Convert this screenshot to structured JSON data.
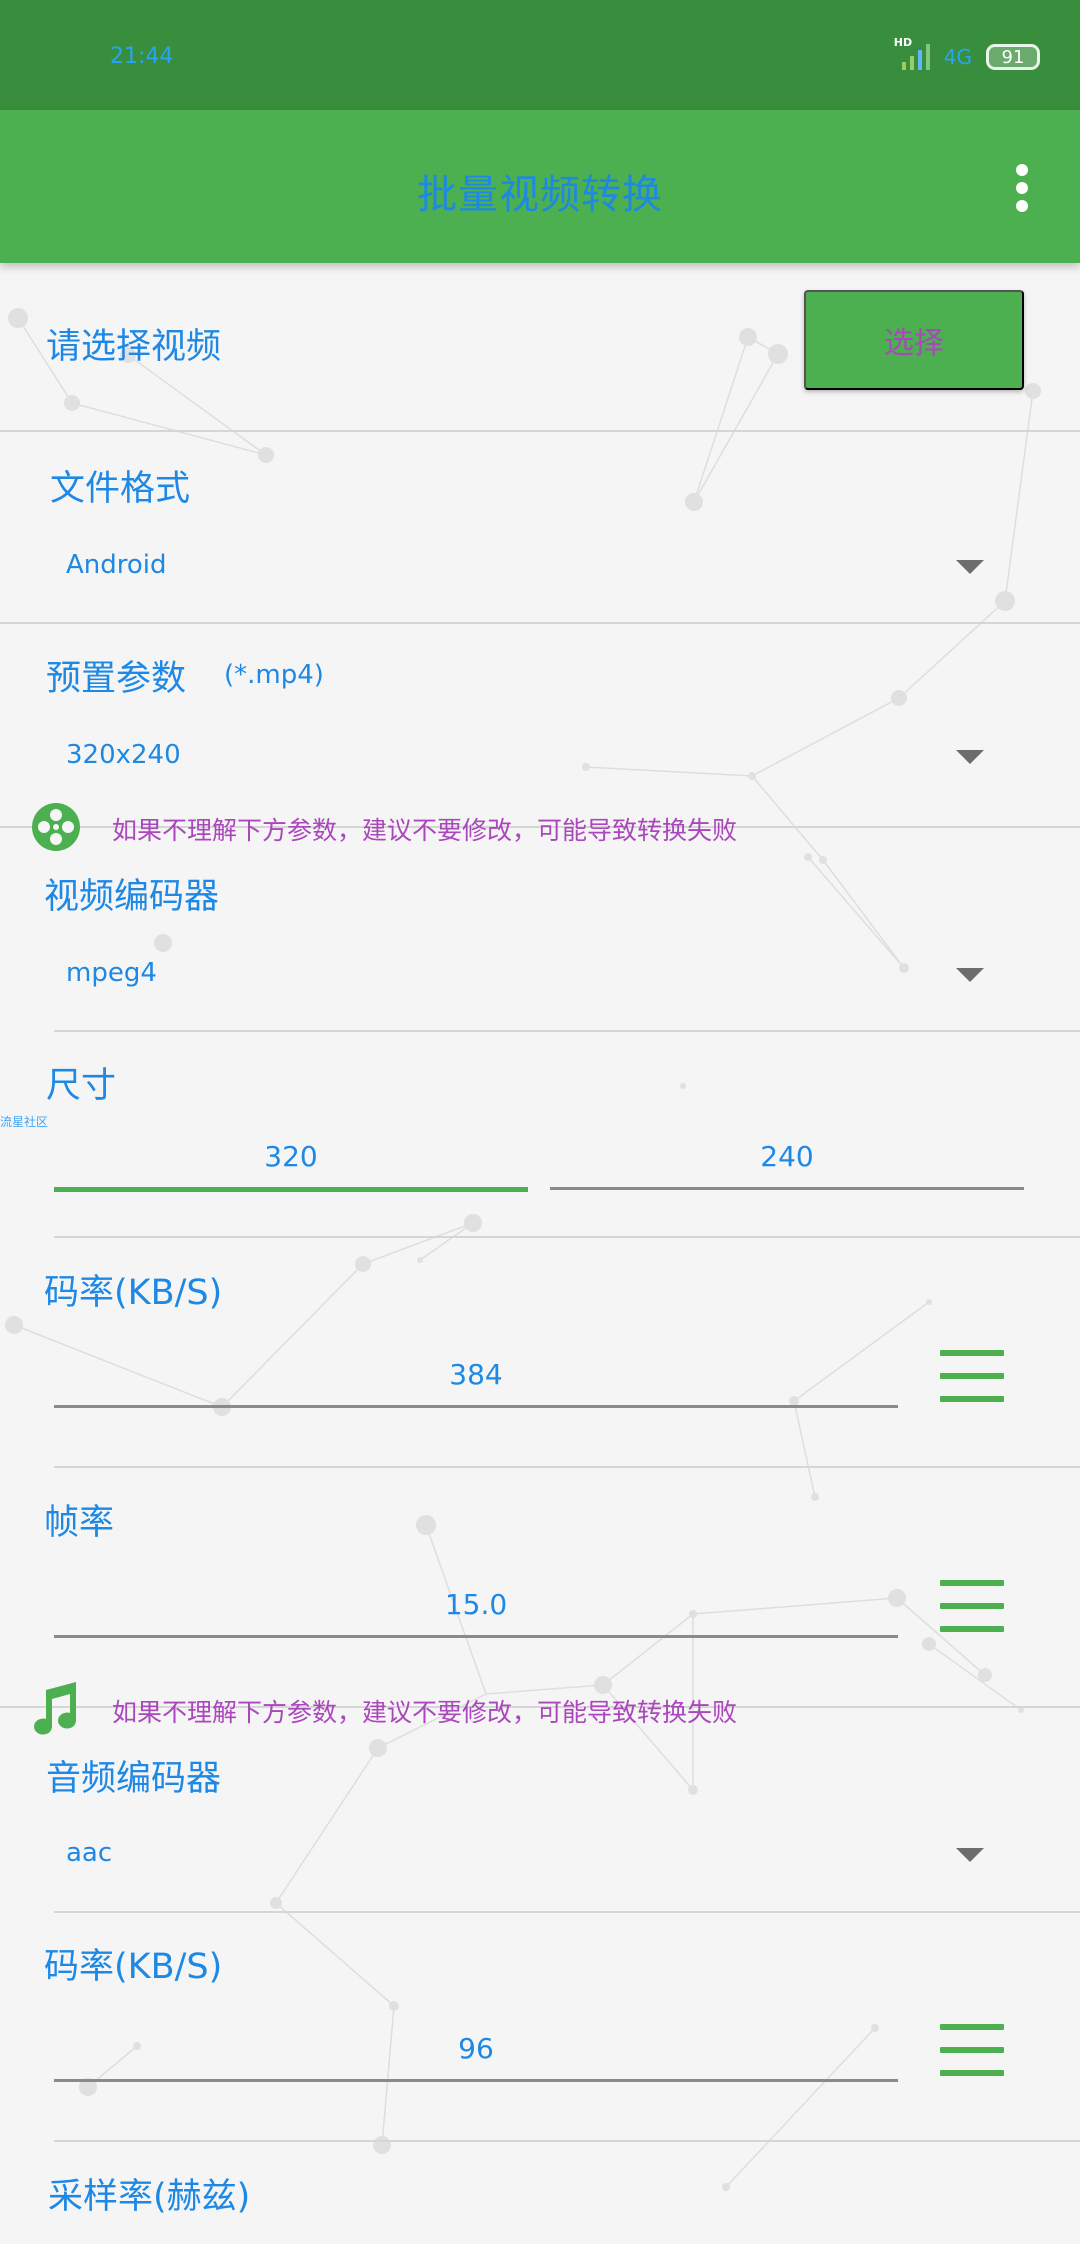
{
  "status_bar": {
    "time": "21:44",
    "hd_label": "HD",
    "network": "4G",
    "battery": "91"
  },
  "app_bar": {
    "title": "批量视频转换",
    "menu_icon": "more-vert-icon"
  },
  "select_video": {
    "label": "请选择视频",
    "button_label": "选择"
  },
  "file_format": {
    "label": "文件格式",
    "selected": "Android"
  },
  "preset": {
    "label": "预置参数",
    "hint": "(*.mp4)",
    "selected": "320x240"
  },
  "video_section": {
    "icon": "film-reel-icon",
    "warning": "如果不理解下方参数，建议不要修改，可能导致转换失败"
  },
  "video_codec": {
    "label": "视频编码器",
    "selected": "mpeg4"
  },
  "size": {
    "label": "尺寸",
    "width": "320",
    "height": "240"
  },
  "watermark": "流星社区",
  "video_bitrate": {
    "label": "码率(KB/S)",
    "value": "384",
    "menu_icon": "list-menu-icon"
  },
  "frame_rate": {
    "label": "帧率",
    "value": "15.0",
    "menu_icon": "list-menu-icon"
  },
  "audio_section": {
    "icon": "music-note-icon",
    "warning": "如果不理解下方参数，建议不要修改，可能导致转换失败"
  },
  "audio_codec": {
    "label": "音频编码器",
    "selected": "aac"
  },
  "audio_bitrate": {
    "label": "码率(KB/S)",
    "value": "96",
    "menu_icon": "list-menu-icon"
  },
  "sample_rate": {
    "label": "采样率(赫兹)"
  },
  "colors": {
    "status_bar": "#388e3c",
    "app_bar": "#4caf50",
    "accent": "#4caf50",
    "text": "#1e88e5",
    "warning_text": "#ab47bc",
    "background": "#f5f5f5"
  }
}
